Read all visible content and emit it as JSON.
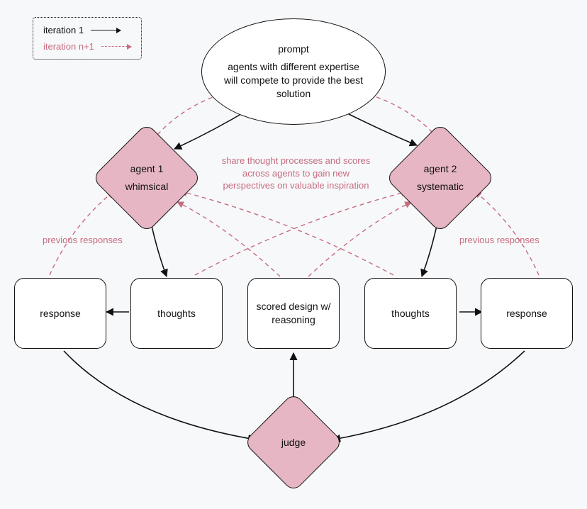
{
  "legend": {
    "iter1": "iteration 1",
    "iterN": "iteration n+1"
  },
  "prompt": {
    "title": "prompt",
    "body": "agents with different expertise will compete to provide the best solution"
  },
  "agents": {
    "a1": {
      "title": "agent 1",
      "type": "whimsical"
    },
    "a2": {
      "title": "agent 2",
      "type": "systematic"
    }
  },
  "boxes": {
    "response_l": "response",
    "thoughts_l": "thoughts",
    "scored": "scored design w/ reasoning",
    "thoughts_r": "thoughts",
    "response_r": "response"
  },
  "judge": "judge",
  "annotations": {
    "share": "share thought processes and scores across agents to gain new perspectives on valuable inspiration",
    "prev_l": "previous responses",
    "prev_r": "previous responses"
  },
  "colors": {
    "pink_fill": "#e6b6c4",
    "pink_line": "#c76b7f",
    "ink": "#111111",
    "bg": "#f7f8fa"
  }
}
